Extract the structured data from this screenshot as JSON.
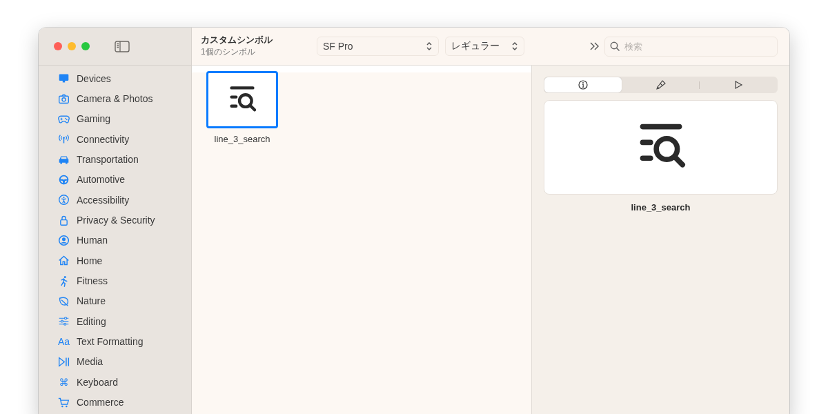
{
  "window": {
    "title": "カスタムシンボル",
    "subtitle": "1個のシンボル"
  },
  "toolbar": {
    "font_popup": "SF Pro",
    "weight_popup": "レギュラー",
    "search": {
      "placeholder": "検索"
    }
  },
  "sidebar": {
    "items": [
      {
        "label": "Devices"
      },
      {
        "label": "Camera & Photos"
      },
      {
        "label": "Gaming"
      },
      {
        "label": "Connectivity"
      },
      {
        "label": "Transportation"
      },
      {
        "label": "Automotive"
      },
      {
        "label": "Accessibility"
      },
      {
        "label": "Privacy & Security"
      },
      {
        "label": "Human"
      },
      {
        "label": "Home"
      },
      {
        "label": "Fitness"
      },
      {
        "label": "Nature"
      },
      {
        "label": "Editing"
      },
      {
        "label": "Text Formatting",
        "icon_text": "Aa"
      },
      {
        "label": "Media"
      },
      {
        "label": "Keyboard",
        "icon_text": "⌘"
      },
      {
        "label": "Commerce"
      }
    ]
  },
  "symbols": [
    {
      "name": "line_3_search",
      "selected": true
    }
  ],
  "inspector": {
    "tabs": [
      {
        "selected": true
      },
      {
        "selected": false
      },
      {
        "selected": false
      }
    ],
    "symbol_name": "line_3_search"
  }
}
